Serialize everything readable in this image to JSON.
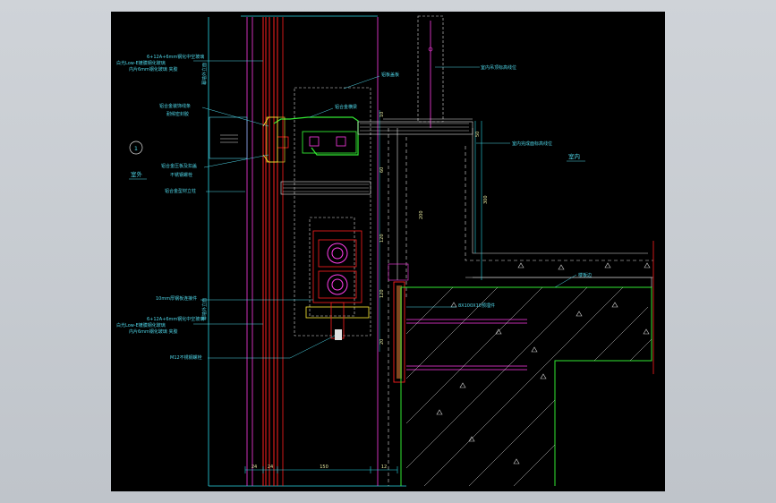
{
  "drawing": {
    "grid_marker": "1",
    "outdoor_label": "室外",
    "indoor_label": "室内",
    "labels": {
      "left_top_1": "6+12A+6mm钢化中空玻璃",
      "left_top_2": "白光Low-E镀膜钢化玻璃",
      "left_top_3": "内片6mm钢化玻璃 夹胶",
      "left_mid_1": "铝合金装饰线条",
      "left_mid_2": "耐候密封胶",
      "left_mid_3": "铝合金压板及扣盖",
      "left_mid_4": "不锈钢螺栓",
      "left_mid_5": "铝合金型材立柱",
      "left_bot_1": "10mm厚钢板连接件",
      "left_bot_2": "6+12A+6mm钢化中空玻璃",
      "left_bot_3": "白光Low-E镀膜钢化玻璃",
      "left_bot_4": "内片6mm钢化玻璃 夹胶",
      "left_bot_5": "M12不锈钢螺栓",
      "vert_left_1": "幕墙外立面",
      "vert_left_2": "幕墙外立面",
      "top_box": "铝板盖板",
      "green_profile": "铝合金横梁",
      "ceiling_1": "室内吊顶标高线位",
      "ceiling_2": "室内完成面标高线位",
      "slab_edge": "楼板边",
      "anchor": "8X100X10预埋件"
    },
    "dims": {
      "bottom_1": "24",
      "bottom_2": "24",
      "bottom_3": "150",
      "bottom_4": "12",
      "right_1": "50",
      "right_2": "200",
      "right_3": "300",
      "right_4": "10",
      "right_5": "60",
      "right_6": "120",
      "right_7": "120",
      "right_8": "20"
    }
  }
}
